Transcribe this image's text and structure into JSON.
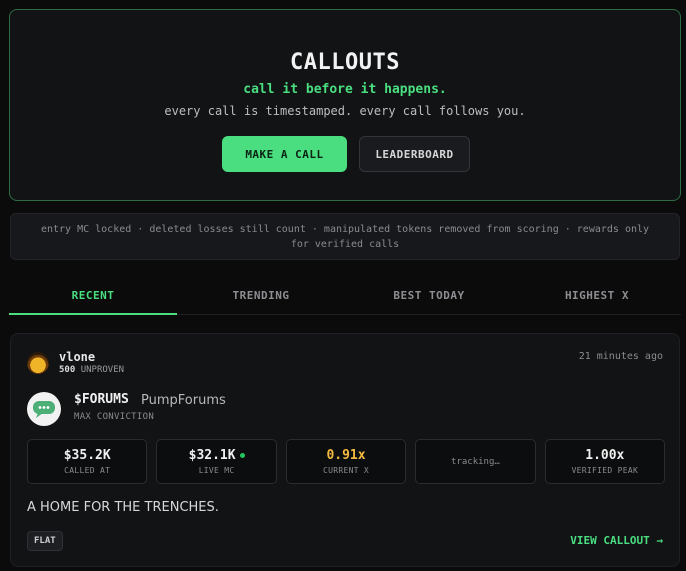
{
  "hero": {
    "title": "CALLOUTS",
    "tagline": "call it before it happens.",
    "subtitle": "every call is timestamped. every call follows you.",
    "primary_button": "MAKE A CALL",
    "secondary_button": "LEADERBOARD"
  },
  "rules_text": "entry MC locked · deleted losses still count · manipulated tokens removed from scoring · rewards only for verified calls",
  "tabs": [
    {
      "label": "RECENT",
      "active": true
    },
    {
      "label": "TRENDING",
      "active": false
    },
    {
      "label": "BEST TODAY",
      "active": false
    },
    {
      "label": "HIGHEST X",
      "active": false
    }
  ],
  "callout": {
    "username": "vlone",
    "reputation_score": "500",
    "reputation_tier": "UNPROVEN",
    "timestamp": "21 minutes ago",
    "ticker": "$FORUMS",
    "token_name": "PumpForums",
    "conviction": "MAX CONVICTION",
    "stats": {
      "called_at": {
        "value": "$35.2K",
        "label": "CALLED AT"
      },
      "live_mc": {
        "value": "$32.1K",
        "label": "LIVE MC"
      },
      "current_x": {
        "value": "0.91x",
        "label": "CURRENT X"
      },
      "tracking": {
        "value": "tracking…"
      },
      "verified_peak": {
        "value": "1.00x",
        "label": "VERIFIED PEAK"
      }
    },
    "pitch": "A HOME FOR THE TRENCHES.",
    "badge": "FLAT",
    "view_link": "VIEW CALLOUT →"
  },
  "colors": {
    "accent": "#4ade80",
    "warning": "#f5b941",
    "background": "#0b0b0c"
  }
}
